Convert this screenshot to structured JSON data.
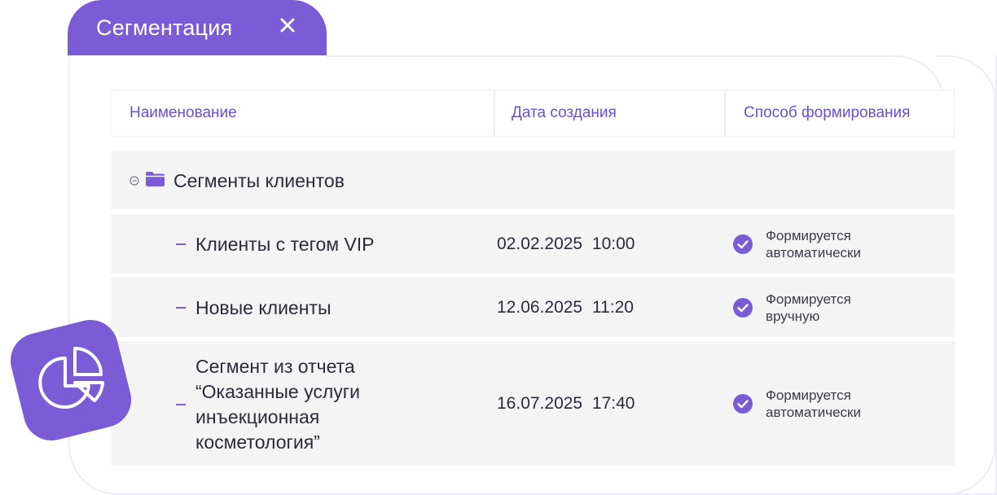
{
  "tab": {
    "title": "Сегментация",
    "close_icon": "close-icon"
  },
  "table": {
    "columns": [
      "Наименование",
      "Дата создания",
      "Способ формирования"
    ],
    "group": {
      "label": "Сегменты клиентов",
      "collapse_icon": "collapse-circle-icon",
      "folder_icon": "folder-icon"
    },
    "rows": [
      {
        "name": [
          "Клиенты с тегом VIP"
        ],
        "date": "02.02.2025 10:00",
        "mode": [
          "Формируется",
          "автоматически"
        ]
      },
      {
        "name": [
          "Новые клиенты"
        ],
        "date": "12.06.2025 11:20",
        "mode": [
          "Формируется",
          "вручную"
        ]
      },
      {
        "name": [
          "Сегмент из отчета",
          "“Оказанные услуги",
          "инъекционная",
          "косметология”"
        ],
        "date": "16.07.2025 17:40",
        "mode": [
          "Формируется",
          "автоматически"
        ]
      }
    ]
  },
  "badge": {
    "icon": "pie-chart-icon"
  },
  "colors": {
    "accent": "#7b5cd6",
    "header_text": "#6a4fd0",
    "row_bg": "#f4f4f4",
    "border": "#eeedf5"
  }
}
